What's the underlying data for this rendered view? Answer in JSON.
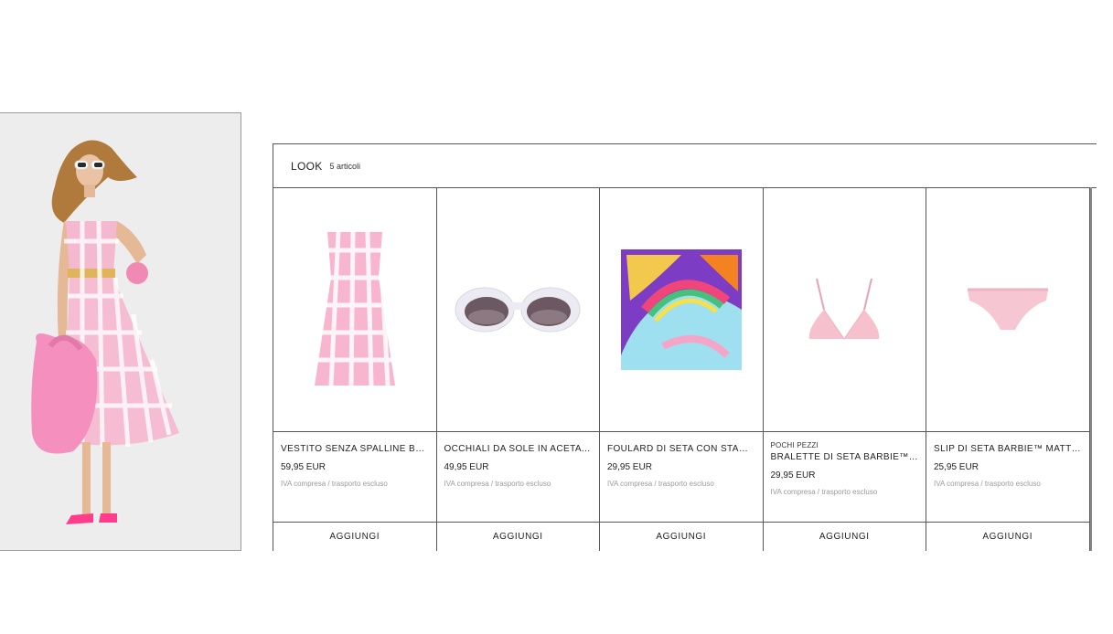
{
  "look": {
    "title": "LOOK",
    "count": "5 articoli"
  },
  "products": [
    {
      "tag": "",
      "name": "VESTITO SENZA SPALLINE BA...",
      "price": "59,95 EUR",
      "tax": "IVA compresa / trasporto escluso",
      "button": "AGGIUNGI",
      "image": "pink-gingham-dress"
    },
    {
      "tag": "",
      "name": "OCCHIALI DA SOLE IN ACETA...",
      "price": "49,95 EUR",
      "tax": "IVA compresa / trasporto escluso",
      "button": "AGGIUNGI",
      "image": "white-sunglasses"
    },
    {
      "tag": "",
      "name": "FOULARD DI SETA CON STAM...",
      "price": "29,95 EUR",
      "tax": "IVA compresa / trasporto escluso",
      "button": "AGGIUNGI",
      "image": "printed-silk-scarf"
    },
    {
      "tag": "POCHI PEZZI",
      "name": "BRALETTE DI SETA BARBIE™ ...",
      "price": "29,95 EUR",
      "tax": "IVA compresa / trasporto escluso",
      "button": "AGGIUNGI",
      "image": "pink-silk-bralette"
    },
    {
      "tag": "",
      "name": "SLIP DI SETA BARBIE™ MATTEL",
      "price": "25,95 EUR",
      "tax": "IVA compresa / trasporto escluso",
      "button": "AGGIUNGI",
      "image": "pink-silk-briefs"
    }
  ],
  "colors": {
    "border": "#555555",
    "pink": "#f2a7c3",
    "tax_text": "#9a9a9a"
  }
}
